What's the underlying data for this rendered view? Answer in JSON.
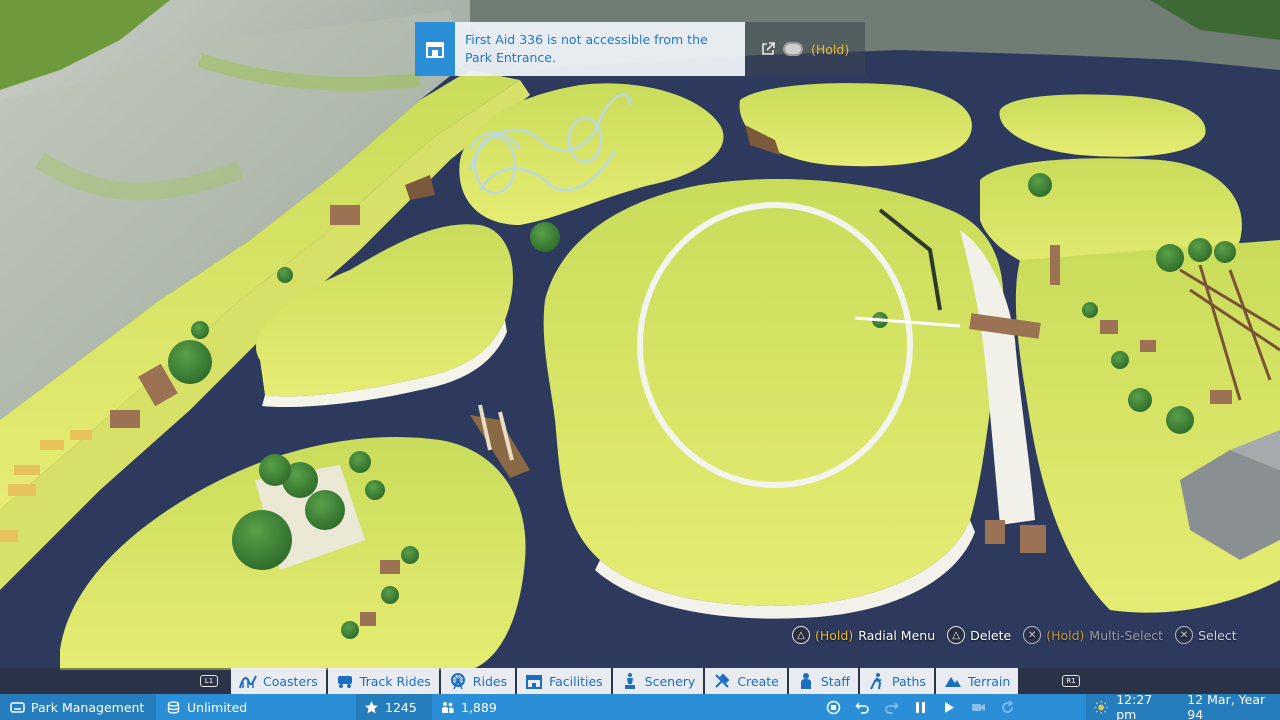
{
  "notification": {
    "message": "First Aid 336 is not accessible from the Park Entrance.",
    "hold_label": "(Hold)",
    "icon": "first-aid-stall-icon"
  },
  "hints": [
    {
      "button": "triangle",
      "hold": "(Hold)",
      "label": "Radial Menu"
    },
    {
      "button": "triangle",
      "label": "Delete"
    },
    {
      "button": "cross",
      "hold": "(Hold)",
      "label": "Multi-Select"
    },
    {
      "button": "cross",
      "label": "Select"
    }
  ],
  "toolbar": {
    "left_bumper": "L1",
    "right_bumper": "R1",
    "tabs": [
      {
        "label": "Coasters",
        "icon": "coaster-icon"
      },
      {
        "label": "Track Rides",
        "icon": "track-ride-icon"
      },
      {
        "label": "Rides",
        "icon": "ferris-wheel-icon"
      },
      {
        "label": "Facilities",
        "icon": "shop-icon"
      },
      {
        "label": "Scenery",
        "icon": "statue-icon"
      },
      {
        "label": "Create",
        "icon": "tools-icon"
      },
      {
        "label": "Staff",
        "icon": "staff-icon"
      },
      {
        "label": "Paths",
        "icon": "path-icon"
      },
      {
        "label": "Terrain",
        "icon": "mountain-icon"
      }
    ]
  },
  "status": {
    "park_management": "Park Management",
    "money": "Unlimited",
    "rating": "1245",
    "guests": "1,889",
    "time": "12:27 pm",
    "date": "12 Mar, Year 94"
  },
  "colors": {
    "accent_blue": "#2b8fd8",
    "hold_yellow": "#f1b82a",
    "grass": "#dfe66a",
    "water": "#2d3a5e"
  }
}
